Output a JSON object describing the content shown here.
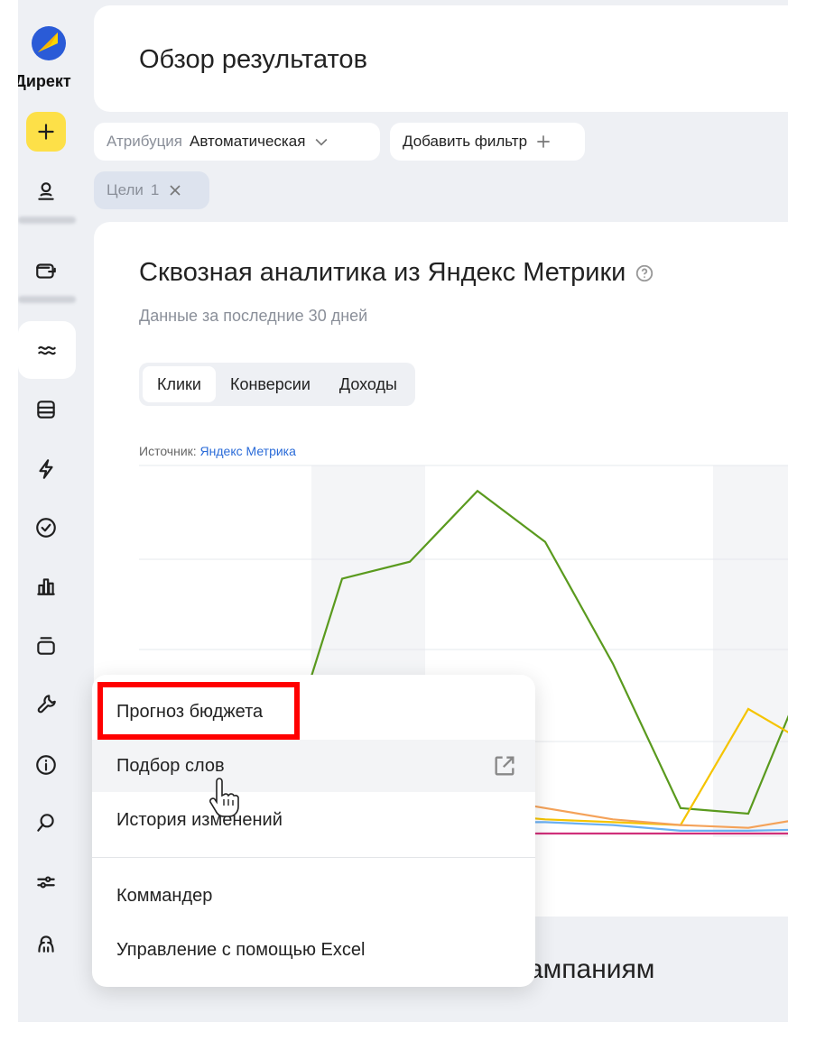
{
  "app": {
    "logo_text": "Директ",
    "brand_color": "#fcd500"
  },
  "header": {
    "title": "Обзор результатов"
  },
  "filters": {
    "attribution_label": "Атрибуция",
    "attribution_value": "Автоматическая",
    "add_filter": "Добавить фильтр",
    "goals_label": "Цели",
    "goals_count": "1"
  },
  "analytics": {
    "title": "Сквозная аналитика из Яндекс Метрики",
    "subtitle": "Данные за последние 30 дней",
    "tabs": [
      "Клики",
      "Конверсии",
      "Доходы"
    ],
    "active_tab": "Клики",
    "source_label": "Источник:",
    "source_link": "Яндекс Метрика"
  },
  "chart_data": {
    "type": "line",
    "title": "",
    "xlabel": "",
    "ylabel": "",
    "series": [
      {
        "color": "#5a9a1e",
        "values": [
          40,
          42,
          28,
          180,
          192,
          242,
          206,
          120,
          18,
          14,
          130
        ]
      },
      {
        "color": "#f5c400",
        "values": [
          10,
          12,
          16,
          14,
          12,
          14,
          10,
          8,
          6,
          88,
          60
        ]
      },
      {
        "color": "#f4a259",
        "values": [
          14,
          18,
          16,
          26,
          22,
          26,
          18,
          10,
          6,
          4,
          12
        ]
      },
      {
        "color": "#6ab0f3",
        "values": [
          2,
          4,
          3,
          6,
          5,
          8,
          8,
          6,
          2,
          2,
          3
        ]
      },
      {
        "color": "#d0307a",
        "values": [
          0,
          0,
          0,
          0,
          0,
          0,
          0,
          0,
          0,
          0,
          0
        ]
      }
    ],
    "grid": true
  },
  "sidebar": {
    "icons": [
      "plus-icon",
      "user-icon",
      "wallet-icon",
      "analytics-icon",
      "campaigns-icon",
      "lightning-icon",
      "check-circle-icon",
      "reports-icon",
      "library-icon",
      "tools-icon",
      "info-icon",
      "search-icon",
      "settings-sliders-icon",
      "help-icon"
    ]
  },
  "tools_menu": {
    "items": [
      "Прогноз бюджета",
      "Подбор слов",
      "История изменений",
      "Коммандер",
      "Управление с помощью Excel"
    ]
  },
  "bottom": {
    "partial_title": "ампаниям"
  }
}
